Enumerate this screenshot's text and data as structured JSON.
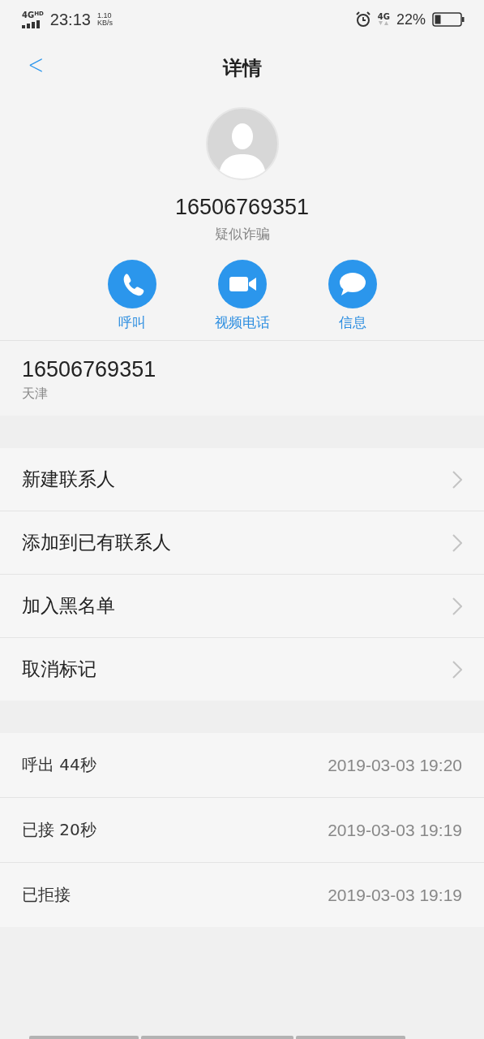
{
  "status_bar": {
    "network": "4G",
    "network_sup": "HD",
    "time": "23:13",
    "speed_value": "1.10",
    "speed_unit": "KB/s",
    "data_type": "4G",
    "battery": "22%"
  },
  "header": {
    "back": "<",
    "title": "详情"
  },
  "profile": {
    "number": "16506769351",
    "tag": "疑似诈骗"
  },
  "actions": [
    {
      "kind": "call",
      "label": "呼叫"
    },
    {
      "kind": "video",
      "label": "视频电话"
    },
    {
      "kind": "message",
      "label": "信息"
    }
  ],
  "number_info": {
    "number": "16506769351",
    "location": "天津"
  },
  "menu": [
    {
      "label": "新建联系人"
    },
    {
      "label": "添加到已有联系人"
    },
    {
      "label": "加入黑名单"
    },
    {
      "label": "取消标记"
    }
  ],
  "call_log": [
    {
      "type": "呼出",
      "duration": "44秒",
      "time": "2019-03-03 19:20"
    },
    {
      "type": "已接",
      "duration": "20秒",
      "time": "2019-03-03 19:19"
    },
    {
      "type": "已拒接",
      "time": "2019-03-03 19:19"
    }
  ]
}
